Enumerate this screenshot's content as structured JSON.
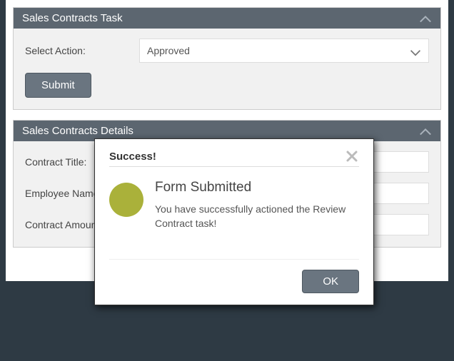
{
  "task_panel": {
    "title": "Sales Contracts Task",
    "select_label": "Select Action:",
    "select_value": "Approved",
    "submit_label": "Submit"
  },
  "details_panel": {
    "title": "Sales Contracts Details",
    "fields": {
      "contract_title_label": "Contract Title:",
      "employee_name_label": "Employee Name:",
      "contract_amount_label": "Contract Amount:"
    }
  },
  "modal": {
    "title": "Success!",
    "heading": "Form Submitted",
    "message": "You have successfully actioned the Review Contract task!",
    "ok_label": "OK"
  }
}
